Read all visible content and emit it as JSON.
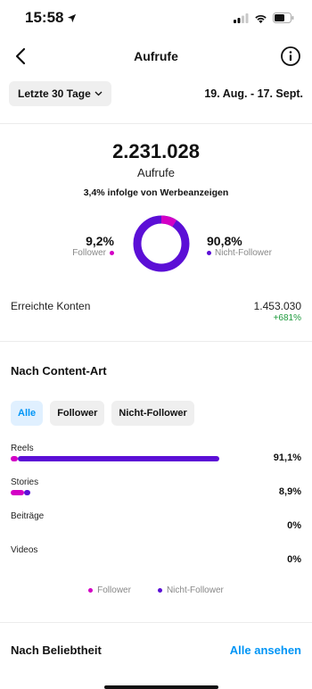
{
  "status_bar": {
    "time": "15:58"
  },
  "header": {
    "title": "Aufrufe"
  },
  "filter": {
    "period_label": "Letzte 30 Tage",
    "date_range": "19. Aug. - 17. Sept."
  },
  "summary": {
    "total": "2.231.028",
    "total_label": "Aufrufe",
    "ads_note": "3,4% infolge von Werbeanzeigen",
    "follower_pct": "9,2%",
    "follower_label": "Follower",
    "non_follower_pct": "90,8%",
    "non_follower_label": "Nicht-Follower"
  },
  "reach": {
    "label": "Erreichte Konten",
    "value": "1.453.030",
    "change": "+681%"
  },
  "content_type": {
    "title": "Nach Content-Art",
    "chips": [
      "Alle",
      "Follower",
      "Nicht-Follower"
    ],
    "rows": [
      {
        "label": "Reels",
        "pct": "91,1%",
        "follower_fraction": 0.03,
        "non_follower_fraction": 0.885
      },
      {
        "label": "Stories",
        "pct": "8,9%",
        "follower_fraction": 0.06,
        "non_follower_fraction": 0.026
      },
      {
        "label": "Beiträge",
        "pct": "0%",
        "follower_fraction": 0,
        "non_follower_fraction": 0
      },
      {
        "label": "Videos",
        "pct": "0%",
        "follower_fraction": 0,
        "non_follower_fraction": 0
      }
    ],
    "legend_follower": "Follower",
    "legend_non_follower": "Nicht-Follower"
  },
  "popularity": {
    "title": "Nach Beliebtheit",
    "see_all": "Alle ansehen"
  },
  "colors": {
    "follower": "#d300c5",
    "non_follower": "#5b0fd6",
    "accent": "#0095f6",
    "positive": "#1d9a3c"
  },
  "donut": {
    "follower_fraction": 0.092,
    "non_follower_fraction": 0.908
  }
}
